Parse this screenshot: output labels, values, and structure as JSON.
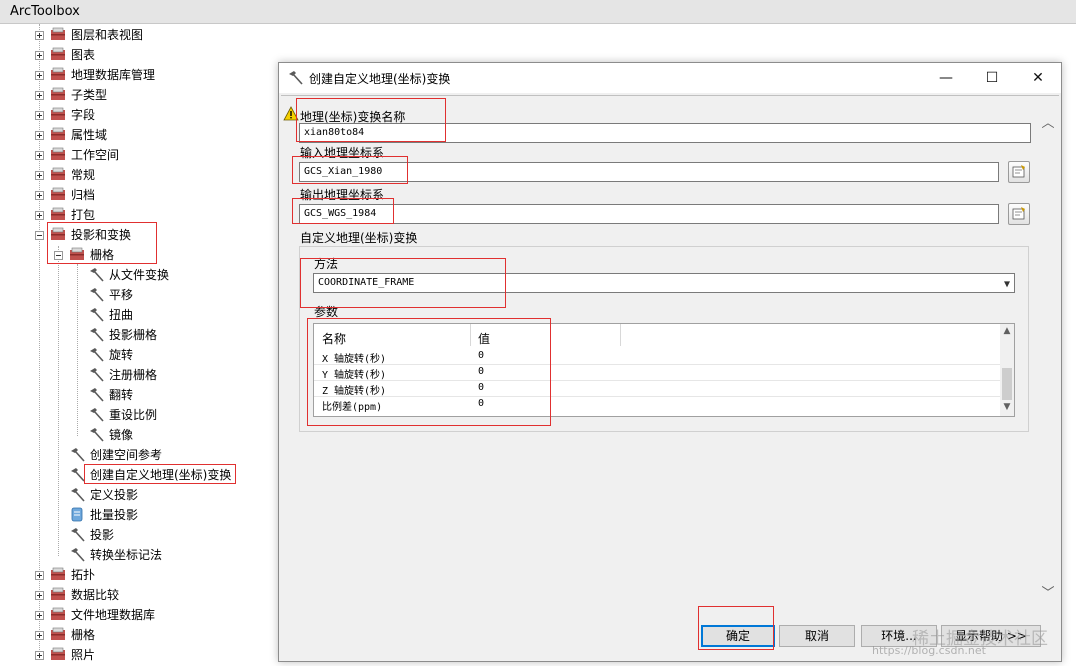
{
  "toolbox": {
    "title": "ArcToolbox",
    "items": [
      {
        "label": "图层和表视图"
      },
      {
        "label": "图表"
      },
      {
        "label": "地理数据库管理"
      },
      {
        "label": "子类型"
      },
      {
        "label": "字段"
      },
      {
        "label": "属性域"
      },
      {
        "label": "工作空间"
      },
      {
        "label": "常规"
      },
      {
        "label": "归档"
      },
      {
        "label": "打包"
      },
      {
        "label": "投影和变换"
      },
      {
        "label": "栅格"
      },
      {
        "label": "从文件变换"
      },
      {
        "label": "平移"
      },
      {
        "label": "扭曲"
      },
      {
        "label": "投影栅格"
      },
      {
        "label": "旋转"
      },
      {
        "label": "注册栅格"
      },
      {
        "label": "翻转"
      },
      {
        "label": "重设比例"
      },
      {
        "label": "镜像"
      },
      {
        "label": "创建空间参考"
      },
      {
        "label": "创建自定义地理(坐标)变换"
      },
      {
        "label": "定义投影"
      },
      {
        "label": "批量投影"
      },
      {
        "label": "投影"
      },
      {
        "label": "转换坐标记法"
      },
      {
        "label": "拓扑"
      },
      {
        "label": "数据比较"
      },
      {
        "label": "文件地理数据库"
      },
      {
        "label": "栅格"
      },
      {
        "label": "照片"
      }
    ]
  },
  "dialog": {
    "title": "创建自定义地理(坐标)变换",
    "fields": {
      "name_label": "地理(坐标)变换名称",
      "name_value": "xian80to84",
      "input_label": "输入地理坐标系",
      "input_value": "GCS_Xian_1980",
      "output_label": "输出地理坐标系",
      "output_value": "GCS_WGS_1984",
      "custom_label": "自定义地理(坐标)变换",
      "method_label": "方法",
      "method_value": "COORDINATE_FRAME",
      "params_label": "参数"
    },
    "params_table": {
      "headers": [
        "名称",
        "值"
      ],
      "rows": [
        {
          "name": "X 轴旋转(秒)",
          "value": "0"
        },
        {
          "name": "Y 轴旋转(秒)",
          "value": "0"
        },
        {
          "name": "Z 轴旋转(秒)",
          "value": "0"
        },
        {
          "name": "比例差(ppm)",
          "value": "0"
        }
      ]
    },
    "buttons": {
      "ok": "确定",
      "cancel": "取消",
      "env": "环境...",
      "help": "显示帮助 >>"
    }
  },
  "watermark": {
    "line1": "https://blog.csdn.net",
    "line2": "稀土掘金技术社区"
  },
  "colors": {
    "highlight_box": "#e03030",
    "toolbox_icon": "#c0504d",
    "hammer": "#5a5a5a"
  }
}
